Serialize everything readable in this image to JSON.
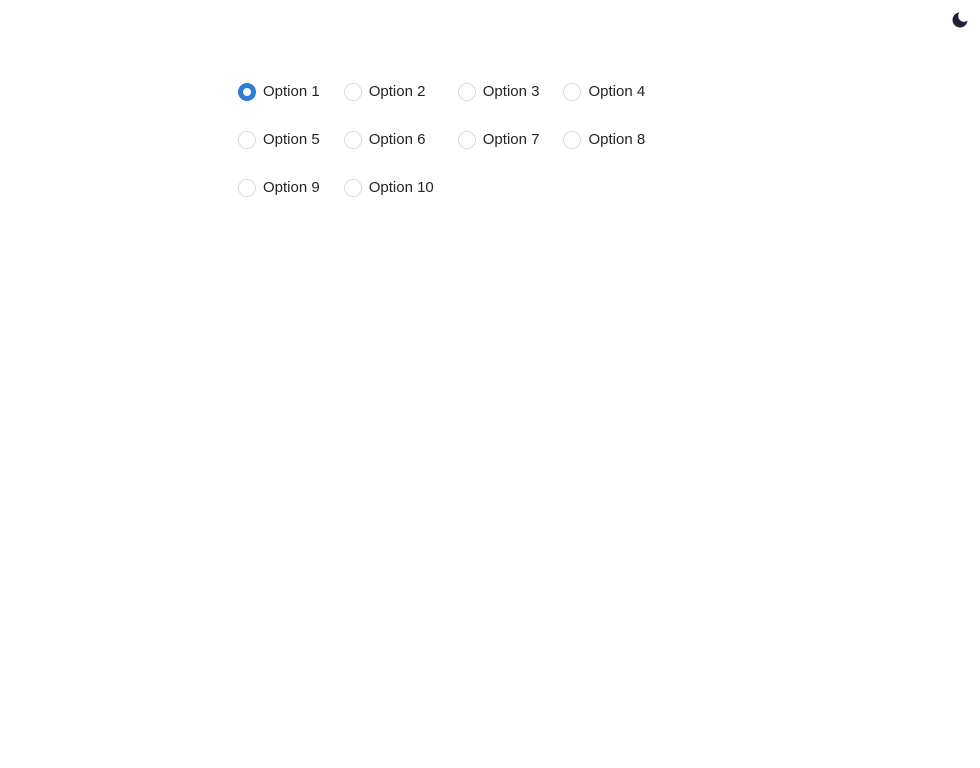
{
  "theme_toggle": {
    "icon": "moon-icon",
    "color": "#1f2233"
  },
  "radio_group": {
    "accent_color": "#2f7dd1",
    "selected": "Option 1",
    "options": [
      {
        "label": "Option 1",
        "checked": true
      },
      {
        "label": "Option 2",
        "checked": false
      },
      {
        "label": "Option 3",
        "checked": false
      },
      {
        "label": "Option 4",
        "checked": false
      },
      {
        "label": "Option 5",
        "checked": false
      },
      {
        "label": "Option 6",
        "checked": false
      },
      {
        "label": "Option 7",
        "checked": false
      },
      {
        "label": "Option 8",
        "checked": false
      },
      {
        "label": "Option 9",
        "checked": false
      },
      {
        "label": "Option 10",
        "checked": false
      }
    ]
  }
}
